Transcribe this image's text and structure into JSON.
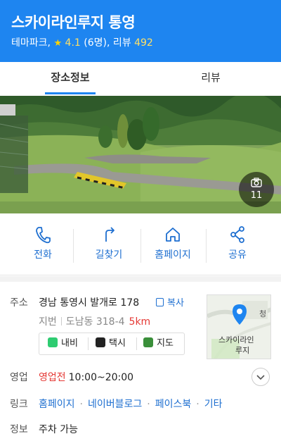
{
  "header": {
    "title": "스카이라인루지 통영",
    "category": "테마파크,",
    "rating": "4.1",
    "rating_count": "(6명),",
    "review_label": "리뷰",
    "review_count": "492",
    "color": "#1e85f0"
  },
  "tabs": [
    {
      "label": "장소정보",
      "active": true
    },
    {
      "label": "리뷰",
      "active": false
    }
  ],
  "photo": {
    "count": "11",
    "icon": "camera-icon"
  },
  "actions": [
    {
      "label": "전화",
      "icon": "phone-icon"
    },
    {
      "label": "길찾기",
      "icon": "directions-icon"
    },
    {
      "label": "홈페이지",
      "icon": "home-icon"
    },
    {
      "label": "공유",
      "icon": "share-icon"
    }
  ],
  "address": {
    "label": "주소",
    "value": "경남 통영시 발개로 178",
    "copy_label": "복사",
    "jibun_label": "지번",
    "jibun_value": "도남동 318-4",
    "distance": "5km"
  },
  "nav_buttons": [
    {
      "label": "내비",
      "icon": "kakao-navi-icon",
      "color": "#2ecc71"
    },
    {
      "label": "택시",
      "icon": "taxi-icon",
      "color": "#222222"
    },
    {
      "label": "지도",
      "icon": "map-pin-icon",
      "color": "#3a8f3a"
    }
  ],
  "map_thumb": {
    "label_top": "청",
    "place_line1": "스카이라인",
    "place_line2": "루지"
  },
  "hours": {
    "label": "영업",
    "status": "영업전",
    "time": "10:00~20:00"
  },
  "links": {
    "label": "링크",
    "items": [
      "홈페이지",
      "네이버블로그",
      "페이스북",
      "기타"
    ]
  },
  "info": {
    "label": "정보",
    "value": "주차 가능"
  },
  "colors": {
    "accent": "#1e85f0",
    "link": "#1e6fd0",
    "alert": "#e53935"
  }
}
